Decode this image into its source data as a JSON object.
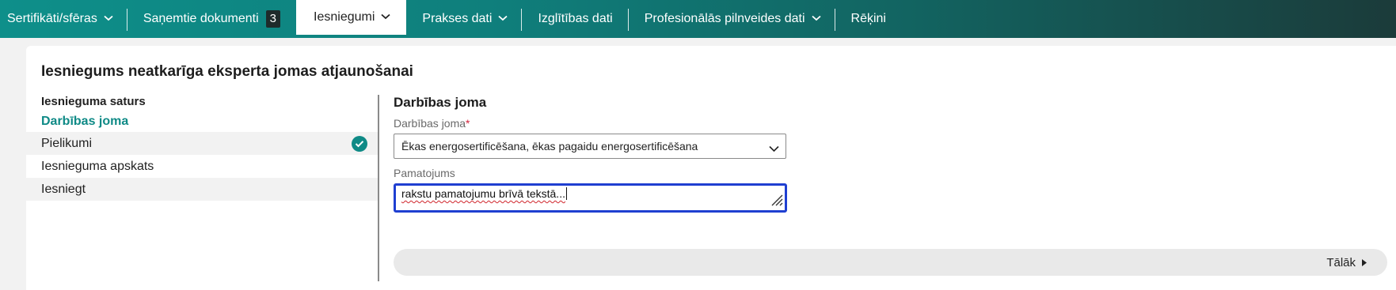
{
  "nav": {
    "items": [
      {
        "label": "Sertifikāti/sfēras",
        "dropdown": true
      },
      {
        "label": "Saņemtie dokumenti",
        "badge": "3"
      },
      {
        "label": "Iesniegumi",
        "dropdown": true,
        "active": true
      },
      {
        "label": "Prakses dati",
        "dropdown": true
      },
      {
        "label": "Izglītības dati"
      },
      {
        "label": "Profesionālās pilnveides dati",
        "dropdown": true
      },
      {
        "label": "Rēķini"
      }
    ]
  },
  "page": {
    "title": "Iesniegums neatkarīga eksperta jomas atjaunošanai"
  },
  "sidebar": {
    "title": "Iesnieguma saturs",
    "steps": [
      {
        "label": "Darbības joma",
        "state": "current"
      },
      {
        "label": "Pielikumi",
        "state": "completed"
      },
      {
        "label": "Iesnieguma apskats",
        "state": "pending"
      },
      {
        "label": "Iesniegt",
        "state": "pending"
      }
    ]
  },
  "form": {
    "section_title": "Darbības joma",
    "field_label": "Darbības joma",
    "required_mark": "*",
    "field_value": "Ēkas energosertificēšana, ēkas pagaidu energosertificēšana",
    "justification_label": "Pamatojums",
    "justification_value": "rakstu pamatojumu brīvā tekstā..."
  },
  "footer": {
    "next_label": "Tālāk"
  },
  "colors": {
    "accent": "#0f8a86",
    "focus": "#1f3fd1",
    "required": "#d2233c"
  }
}
